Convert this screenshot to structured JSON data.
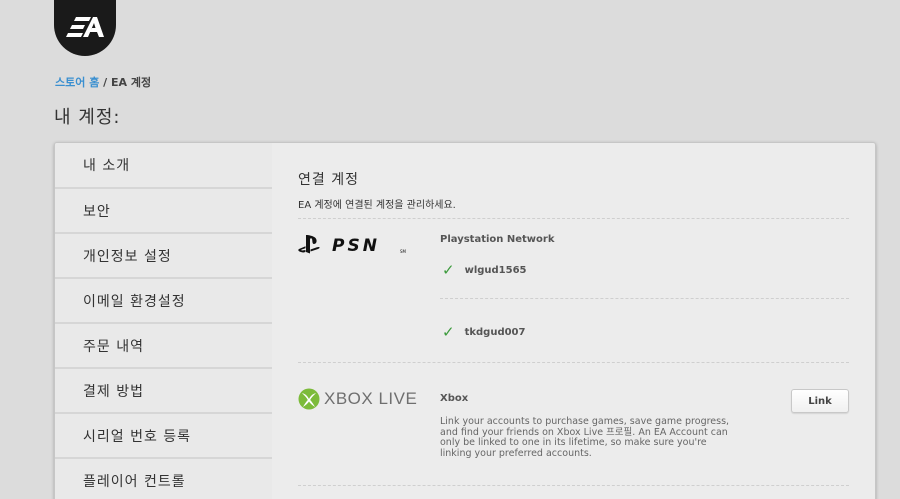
{
  "brand": {
    "logo_text": "EA"
  },
  "breadcrumb": {
    "home": "스토어 홈",
    "separator": " / ",
    "current": "EA 계정"
  },
  "page_title": "내 계정:",
  "sidebar": {
    "items": [
      {
        "label": "내 소개"
      },
      {
        "label": "보안"
      },
      {
        "label": "개인정보 설정"
      },
      {
        "label": "이메일 환경설정"
      },
      {
        "label": "주문 내역"
      },
      {
        "label": "결제 방법"
      },
      {
        "label": "시리얼 번호 등록"
      },
      {
        "label": "플레이어 컨트롤"
      }
    ]
  },
  "content": {
    "title": "연결 계정",
    "subtitle": "EA 계정에 연결된 계정을 관리하세요.",
    "psn": {
      "logo_text": "PSN",
      "heading": "Playstation Network",
      "accounts": [
        "wlgud1565",
        "tkdgud007"
      ]
    },
    "xbox": {
      "logo_text": "XBOX LIVE",
      "heading": "Xbox",
      "description": "Link your accounts to purchase games, save game progress, and find your friends on Xbox Live 프로필. An EA Account can only be linked to one in its lifetime, so make sure you're linking your preferred accounts.",
      "button_label": "Link"
    }
  },
  "colors": {
    "link": "#3a8fd0",
    "check": "#3d9b3d",
    "xbox_green": "#7cbb3a"
  }
}
